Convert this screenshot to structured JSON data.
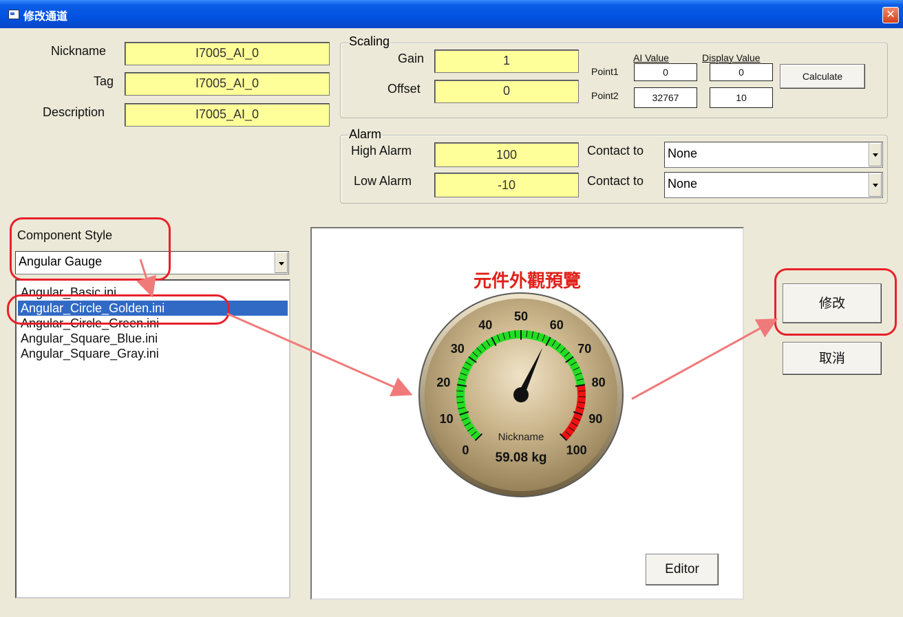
{
  "window": {
    "title": "修改通道",
    "close_glyph": "✕"
  },
  "fields": {
    "nickname": {
      "label": "Nickname",
      "value": "I7005_AI_0"
    },
    "tag": {
      "label": "Tag",
      "value": "I7005_AI_0"
    },
    "description": {
      "label": "Description",
      "value": "I7005_AI_0"
    }
  },
  "scaling": {
    "title": "Scaling",
    "gain_label": "Gain",
    "gain_value": "1",
    "offset_label": "Offset",
    "offset_value": "0",
    "ai_value_header": "AI Value",
    "display_value_header": "Display Value",
    "point1_label": "Point1",
    "point1_ai": "0",
    "point1_display": "0",
    "point2_label": "Point2",
    "point2_ai": "32767",
    "point2_display": "10",
    "calculate_label": "Calculate"
  },
  "alarm": {
    "title": "Alarm",
    "high_label": "High Alarm",
    "high_value": "100",
    "low_label": "Low Alarm",
    "low_value": "-10",
    "contact_label_1": "Contact to",
    "contact_value_1": "None",
    "contact_label_2": "Contact to",
    "contact_value_2": "None"
  },
  "component": {
    "label": "Component Style",
    "selected": "Angular Gauge",
    "files": [
      "Angular_Basic.ini",
      "Angular_Circle_Golden.ini",
      "Angular_Circle_Green.ini",
      "Angular_Square_Blue.ini",
      "Angular_Square_Gray.ini"
    ],
    "selected_index": 1
  },
  "preview": {
    "title": "元件外觀預覽",
    "editor_label": "Editor",
    "gauge": {
      "min": 0,
      "max": 100,
      "value": 59.08,
      "ticks": [
        "0",
        "10",
        "20",
        "30",
        "40",
        "50",
        "60",
        "70",
        "80",
        "90",
        "100"
      ],
      "caption": "Nickname",
      "reading": "59.08 kg",
      "green_range": [
        0,
        80
      ],
      "red_range": [
        80,
        100
      ],
      "colors": {
        "green": "#22dd22",
        "red": "#ee1111",
        "face": "#c9b38a"
      }
    }
  },
  "buttons": {
    "modify": "修改",
    "cancel": "取消"
  },
  "annotation": {
    "color": "#e8202a",
    "arrow_color": "#f07a7a"
  }
}
